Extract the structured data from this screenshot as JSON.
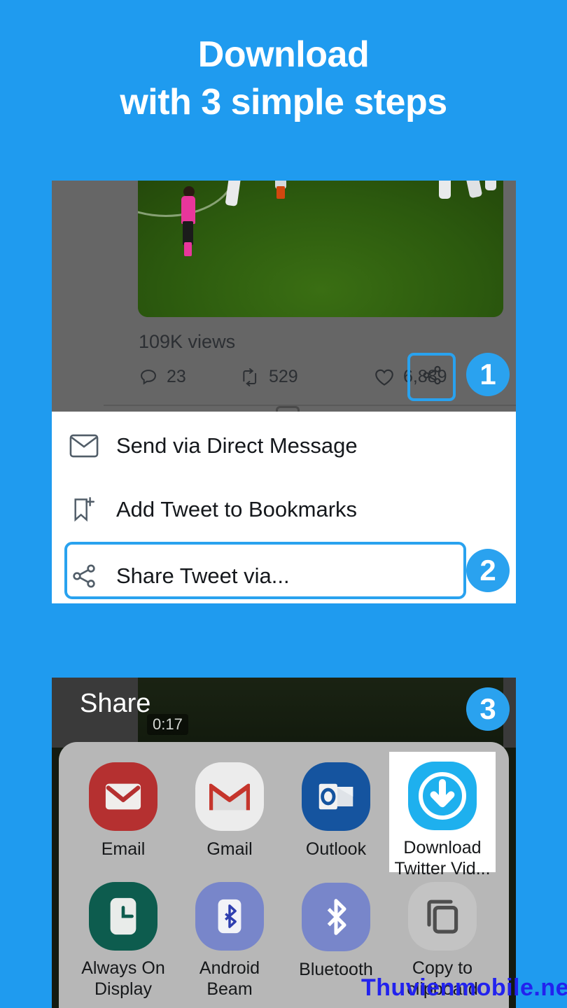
{
  "theme": {
    "background_blue": "#1f9bef",
    "accent_blue": "#2aa2ef",
    "panel_dim_gray": "#666666",
    "sheet_gray": "#b7b7b7"
  },
  "title": {
    "line1": "Download",
    "line2": "with 3 simple steps"
  },
  "step1": {
    "badge": "1",
    "views": "109K views",
    "metrics": [
      {
        "icon": "reply-icon",
        "value": "23"
      },
      {
        "icon": "retweet-icon",
        "value": "529"
      },
      {
        "icon": "like-icon",
        "value": "6,889"
      }
    ],
    "share_button_icon": "share-icon"
  },
  "step2": {
    "badge": "2",
    "items": [
      {
        "icon": "envelope-icon",
        "label": "Send via Direct Message",
        "highlighted": false
      },
      {
        "icon": "bookmark-add-icon",
        "label": "Add Tweet to Bookmarks",
        "highlighted": false
      },
      {
        "icon": "share-icon",
        "label": "Share Tweet via...",
        "highlighted": true
      }
    ]
  },
  "step3": {
    "badge": "3",
    "sheet_title": "Share",
    "video_duration": "0:17",
    "apps": [
      {
        "icon": "email-icon",
        "label": "Email",
        "highlighted": false
      },
      {
        "icon": "gmail-icon",
        "label": "Gmail",
        "highlighted": false
      },
      {
        "icon": "outlook-icon",
        "label": "Outlook",
        "highlighted": false
      },
      {
        "icon": "download-twitter-video-icon",
        "label": "Download\nTwitter Vid...",
        "label_line1": "Download",
        "label_line2": "Twitter Vid...",
        "highlighted": true
      },
      {
        "icon": "always-on-display-icon",
        "label_line1": "Always On",
        "label_line2": "Display",
        "highlighted": false
      },
      {
        "icon": "android-beam-icon",
        "label_line1": "Android",
        "label_line2": "Beam",
        "highlighted": false
      },
      {
        "icon": "bluetooth-icon",
        "label_line1": "Bluetooth",
        "label_line2": "",
        "highlighted": false
      },
      {
        "icon": "copy-to-clipboard-icon",
        "label_line1": "Copy to",
        "label_line2": "clipboard",
        "highlighted": false
      }
    ]
  },
  "watermark": "Thuvienmobile.net"
}
